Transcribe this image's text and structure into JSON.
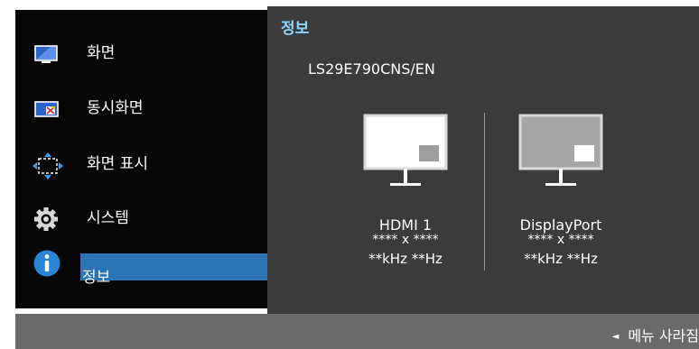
{
  "menu": {
    "items": [
      {
        "label": "화면",
        "icon": "picture-icon"
      },
      {
        "label": "동시화면",
        "icon": "pip-pbp-icon"
      },
      {
        "label": "화면 표시",
        "icon": "onscreen-display-icon"
      },
      {
        "label": "시스템",
        "icon": "gear-icon"
      },
      {
        "label": "정보",
        "icon": "info-icon",
        "selected": true
      }
    ]
  },
  "info": {
    "title": "정보",
    "model": "LS29E790CNS/EN",
    "sources": [
      {
        "name": "HDMI 1",
        "resolution": "**** x ****",
        "frequency": "**kHz **Hz",
        "active": true
      },
      {
        "name": "DisplayPort",
        "resolution": "**** x ****",
        "frequency": "**kHz **Hz",
        "active": false
      }
    ]
  },
  "footer": {
    "hide_menu_label": "메뉴 사라짐"
  },
  "colors": {
    "menu_bg": "#060606",
    "panel_bg": "#3b3b3b",
    "highlight": "#2b74b6",
    "title_accent": "#8fd3ff",
    "footer_bg": "#6a6a6a"
  }
}
